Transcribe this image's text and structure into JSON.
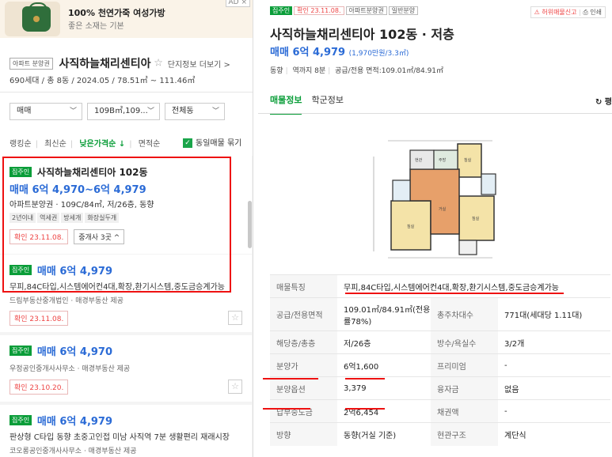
{
  "ad": {
    "title": "100% 천연가죽 여성가방",
    "subtitle": "좋은 소재는 기본",
    "badge": "AD ×"
  },
  "complex": {
    "tag": "아파트 분양권",
    "name": "사직하늘채리센티아",
    "detail_link": "단지정보 더보기 >",
    "info": "690세대 / 총 8동 / 2024.05 / 78.51㎡ ~ 111.46㎡"
  },
  "filters": {
    "trade": "매매",
    "area": "109B㎡,109...",
    "dong": "전체동"
  },
  "sort": {
    "items": [
      "랭킹순",
      "최신순",
      "낮은가격순 ↓",
      "면적순"
    ],
    "active_index": 2,
    "same_listing_label": "동일매물 묶기"
  },
  "listings": [
    {
      "tag": "집주인",
      "title": "사직하늘채리센티아 102동",
      "price": "매매 6억 4,970~6억 4,979",
      "info": "아파트분양권 · 109C/84㎡, 저/26층, 동향",
      "features": [
        "2년이내",
        "역세권",
        "방세개",
        "화장실두개"
      ],
      "confirm": "확인 23.11.08.",
      "agents": "중개사 3곳 ^"
    },
    {
      "tag": "집주인",
      "price": "매매 6억 4,979",
      "desc": "무피,84C타입,시스템에어컨4대,확장,환기시스템,중도금승계가능",
      "agent": "드림부동산중개법인 · 매경부동산 제공",
      "confirm": "확인 23.11.08."
    },
    {
      "tag": "집주인",
      "price": "매매 6억 4,970",
      "agent": "우정공인중개사사무소 · 매경부동산 제공",
      "confirm": "확인 23.10.20."
    },
    {
      "tag": "집주인",
      "price": "매매 6억 4,979",
      "desc": "판상형 C타입 동향 초중고인접 미남 사직역 7분 생활편리 재래시장",
      "agent": "코오롱공인중개사사무소 · 매경부동산 제공"
    }
  ],
  "detail": {
    "tags": [
      "집주인",
      "확인 23.11.08.",
      "아파트분양권",
      "일반분양"
    ],
    "actions": {
      "report": "허위매물신고",
      "print": "인쇄"
    },
    "title": "사직하늘채리센티아 102동 · 저층",
    "price": "매매 6억 4,979",
    "price_per": "(1,970만원/3.3㎡)",
    "sub": [
      "동향",
      "역까지 8분",
      "공급/전용 면적:109.01㎡/84.91㎡"
    ],
    "tabs": [
      "매물정보",
      "학군정보"
    ],
    "refresh": "↻ 평",
    "table": [
      {
        "k1": "매물특징",
        "v1": "무피,84C타입,시스템에어컨4대,확장,환기시스템,중도금승계가능",
        "k2": "",
        "v2": ""
      },
      {
        "k1": "공급/전용면적",
        "v1": "109.01㎡/84.91㎡(전용률78%)",
        "k2": "총주차대수",
        "v2": "771대(세대당 1.11대)"
      },
      {
        "k1": "해당층/총층",
        "v1": "저/26층",
        "k2": "방수/욕실수",
        "v2": "3/2개"
      },
      {
        "k1": "분양가",
        "v1": "6억1,600",
        "k2": "프리미엄",
        "v2": "-"
      },
      {
        "k1": "분양옵션",
        "v1": "3,379",
        "k2": "융자금",
        "v2": "없음"
      },
      {
        "k1": "납부중도금",
        "v1": "2억6,454",
        "k2": "채권액",
        "v2": "-"
      },
      {
        "k1": "방향",
        "v1": "동향(거실 기준)",
        "k2": "현관구조",
        "v2": "계단식"
      }
    ]
  },
  "colors": {
    "accent_green": "#0a9d39",
    "price_blue": "#2b6bd6",
    "highlight_red": "#e11111"
  }
}
